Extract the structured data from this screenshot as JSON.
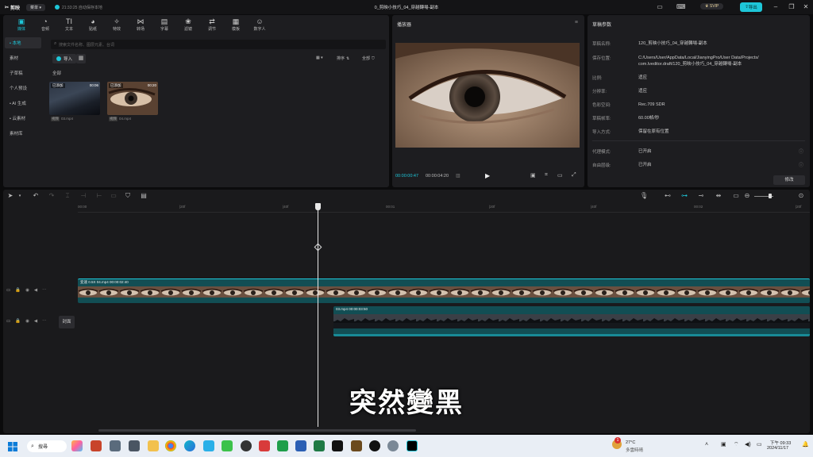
{
  "titlebar": {
    "app_name": "剪映",
    "menu": "菜单",
    "save_status": "21:33:25 自动保存本地",
    "project_title": "0_剪映小技巧_04_穿越轉場-副本",
    "svip": "SVIP",
    "export": "导出"
  },
  "toolbar": [
    {
      "label": "媒体",
      "icon": "media-icon"
    },
    {
      "label": "音频",
      "icon": "audio-icon"
    },
    {
      "label": "文本",
      "icon": "text-icon"
    },
    {
      "label": "贴纸",
      "icon": "sticker-icon"
    },
    {
      "label": "特效",
      "icon": "effects-icon"
    },
    {
      "label": "转场",
      "icon": "transition-icon"
    },
    {
      "label": "字幕",
      "icon": "caption-icon"
    },
    {
      "label": "滤镜",
      "icon": "filter-icon"
    },
    {
      "label": "调节",
      "icon": "adjust-icon"
    },
    {
      "label": "模板",
      "icon": "template-icon"
    },
    {
      "label": "数字人",
      "icon": "avatar-icon"
    }
  ],
  "sidebar": [
    {
      "label": "• 本地"
    },
    {
      "label": "素材"
    },
    {
      "label": "子草稿"
    },
    {
      "label": "个人预设"
    },
    {
      "label": "• AI 生成"
    },
    {
      "label": "• 云素材"
    },
    {
      "label": "素材库"
    }
  ],
  "media": {
    "search_placeholder": "搜索文件名称、图层元素、台词",
    "import": "导入",
    "sort": "排序",
    "filter_all": "全部",
    "section_all": "全部",
    "clips": [
      {
        "badge": "已添加",
        "duration": "00:06",
        "tag": "视频",
        "name": "03.mp4"
      },
      {
        "badge": "已添加",
        "duration": "00:20",
        "tag": "视频",
        "name": "04.mp4"
      }
    ]
  },
  "player": {
    "title": "播放器",
    "current_time": "00:00:00:47",
    "total_time": "00:00:04:20"
  },
  "draft": {
    "title": "草稿参数",
    "params": [
      {
        "k": "草稿名称:",
        "v": "120_剪映小技巧_04_穿越轉場-副本"
      },
      {
        "k": "保存位置:",
        "v": "C:/Users/User/AppData/Local/JianyingPro/User Data/Projects/"
      },
      {
        "k": "",
        "v": "com.lveditor.draft/120_剪映小技巧_04_穿越轉場-副本"
      },
      {
        "k": "比例:",
        "v": "适应"
      },
      {
        "k": "分辨率:",
        "v": "适应"
      },
      {
        "k": "色彩空间:",
        "v": "Rec.709 SDR"
      },
      {
        "k": "草稿帧率:",
        "v": "60.00帧/秒"
      },
      {
        "k": "导入方式:",
        "v": "保留在原有位置"
      },
      {
        "k": "代理模式:",
        "v": "已开启"
      },
      {
        "k": "自由层级:",
        "v": "已开启"
      }
    ],
    "modify": "修改"
  },
  "timeline": {
    "ruler_ticks": [
      "00:00",
      "|20f",
      "|40f",
      "00:01",
      "|20f",
      "|40f",
      "00:02",
      "|20f"
    ],
    "main_clip_label": "变速 0.5X  04.mp4  00:00:02:40",
    "second_clip_label": "03.mp4  00:00:03:50",
    "cover": "封面"
  },
  "subtitle": "突然變黑",
  "taskbar": {
    "search": "搜尋",
    "weather_temp": "27°C",
    "weather_text": "多雲時晴",
    "badge_count": "1",
    "time": "下午 09:33",
    "date": "2024/11/17"
  },
  "colors": {
    "accent": "#1ec6d8",
    "track": "#124e54"
  }
}
